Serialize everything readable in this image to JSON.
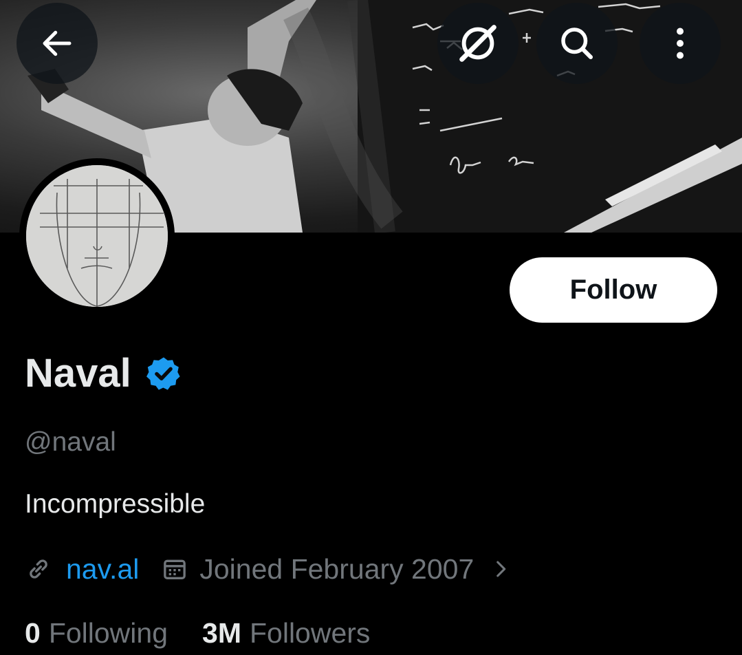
{
  "header": {
    "back_icon": "arrow-left-icon",
    "grok_icon": "grok-icon",
    "search_icon": "search-icon",
    "more_icon": "more-vertical-icon"
  },
  "profile": {
    "name": "Naval",
    "handle": "@naval",
    "bio": "Incompressible",
    "website": "nav.al",
    "joined": "Joined February 2007",
    "verified_color": "#1d9bf0",
    "follow_label": "Follow"
  },
  "stats": {
    "following_count": "0",
    "following_label": "Following",
    "followers_count": "3M",
    "followers_label": "Followers"
  },
  "colors": {
    "background": "#000000",
    "link": "#1d9bf0",
    "secondary_text": "#71767b",
    "primary_text": "#e7e9ea"
  }
}
